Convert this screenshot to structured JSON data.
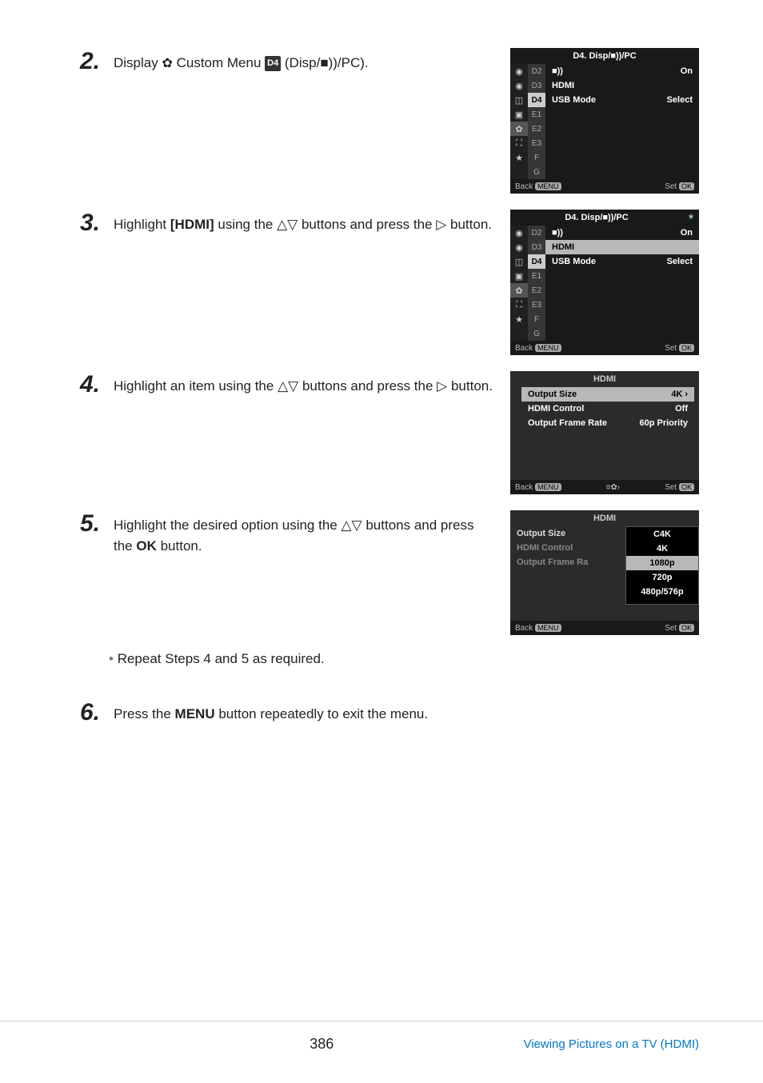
{
  "steps": {
    "s2": {
      "num": "2.",
      "prefix": "Display ",
      "gear": "✿",
      "mid": " Custom Menu ",
      "d4": "D4",
      "suffix": " (Disp/",
      "beep": "■))",
      "tail": "/PC)."
    },
    "s3": {
      "num": "3.",
      "p1": "Highlight ",
      "hdmi_bold": "[HDMI]",
      "p2": " using the ",
      "up": "△",
      "dn": "▽",
      "p3": " buttons and press the ",
      "rt": "▷",
      "p4": " button."
    },
    "s4": {
      "num": "4.",
      "p1": "Highlight an item using the ",
      "up": "△",
      "dn": "▽",
      "p2": " buttons and press the ",
      "rt": "▷",
      "p3": " button."
    },
    "s5": {
      "num": "5.",
      "p1": "Highlight the desired option using the ",
      "up": "△",
      "dn": "▽",
      "p2": " buttons and press the ",
      "ok": "OK",
      "p3": " button."
    },
    "bullet": "Repeat Steps 4 and 5 as required.",
    "s6": {
      "num": "6.",
      "p1": "Press the ",
      "menu": "MENU",
      "p2": " button repeatedly to exit the menu."
    }
  },
  "screen_d4": {
    "title": "D4. Disp/■))/PC",
    "side_icons": [
      "◉",
      "◉",
      "◫",
      "▣",
      "✿",
      "⛶",
      "★"
    ],
    "sub_tabs": [
      "D2",
      "D3",
      "D4",
      "E1",
      "E2",
      "E3",
      "F",
      "G"
    ],
    "active_sub": "D4",
    "rows": [
      {
        "label": "■))",
        "value": "On"
      },
      {
        "label": "HDMI",
        "value": ""
      },
      {
        "label": "USB Mode",
        "value": "Select"
      }
    ],
    "back": "Back",
    "back_btn": "MENU",
    "set": "Set",
    "set_btn": "OK"
  },
  "screen_d4_hdmi": {
    "title": "D4. Disp/■))/PC",
    "side_icons": [
      "◉",
      "◉",
      "◫",
      "▣",
      "✿",
      "⛶",
      "★"
    ],
    "sub_tabs": [
      "D2",
      "D3",
      "D4",
      "E1",
      "E2",
      "E3",
      "F",
      "G"
    ],
    "active_sub": "D3",
    "rows": [
      {
        "label": "■))",
        "value": "On"
      },
      {
        "label": "HDMI",
        "value": ""
      },
      {
        "label": "USB Mode",
        "value": "Select"
      }
    ],
    "highlight_row": 1,
    "back": "Back",
    "back_btn": "MENU",
    "set": "Set",
    "set_btn": "OK",
    "star": "★"
  },
  "screen_hdmi": {
    "title": "HDMI",
    "rows": [
      {
        "label": "Output Size",
        "value": "4K"
      },
      {
        "label": "HDMI Control",
        "value": "Off"
      },
      {
        "label": "Output Frame Rate",
        "value": "60p Priority"
      }
    ],
    "highlight_row": 0,
    "back": "Back",
    "back_btn": "MENU",
    "mid_icon": "≡✿›",
    "set": "Set",
    "set_btn": "OK",
    "chev": "›"
  },
  "screen_hdmi_opts": {
    "title": "HDMI",
    "left_rows": [
      "Output Size",
      "HDMI Control",
      "Output Frame Ra"
    ],
    "options": [
      "C4K",
      "4K",
      "1080p",
      "720p",
      "480p/576p"
    ],
    "highlight_opt": 2,
    "back": "Back",
    "back_btn": "MENU",
    "set": "Set",
    "set_btn": "OK"
  },
  "footer": {
    "page": "386",
    "link": "Viewing Pictures on a TV (HDMI)"
  }
}
